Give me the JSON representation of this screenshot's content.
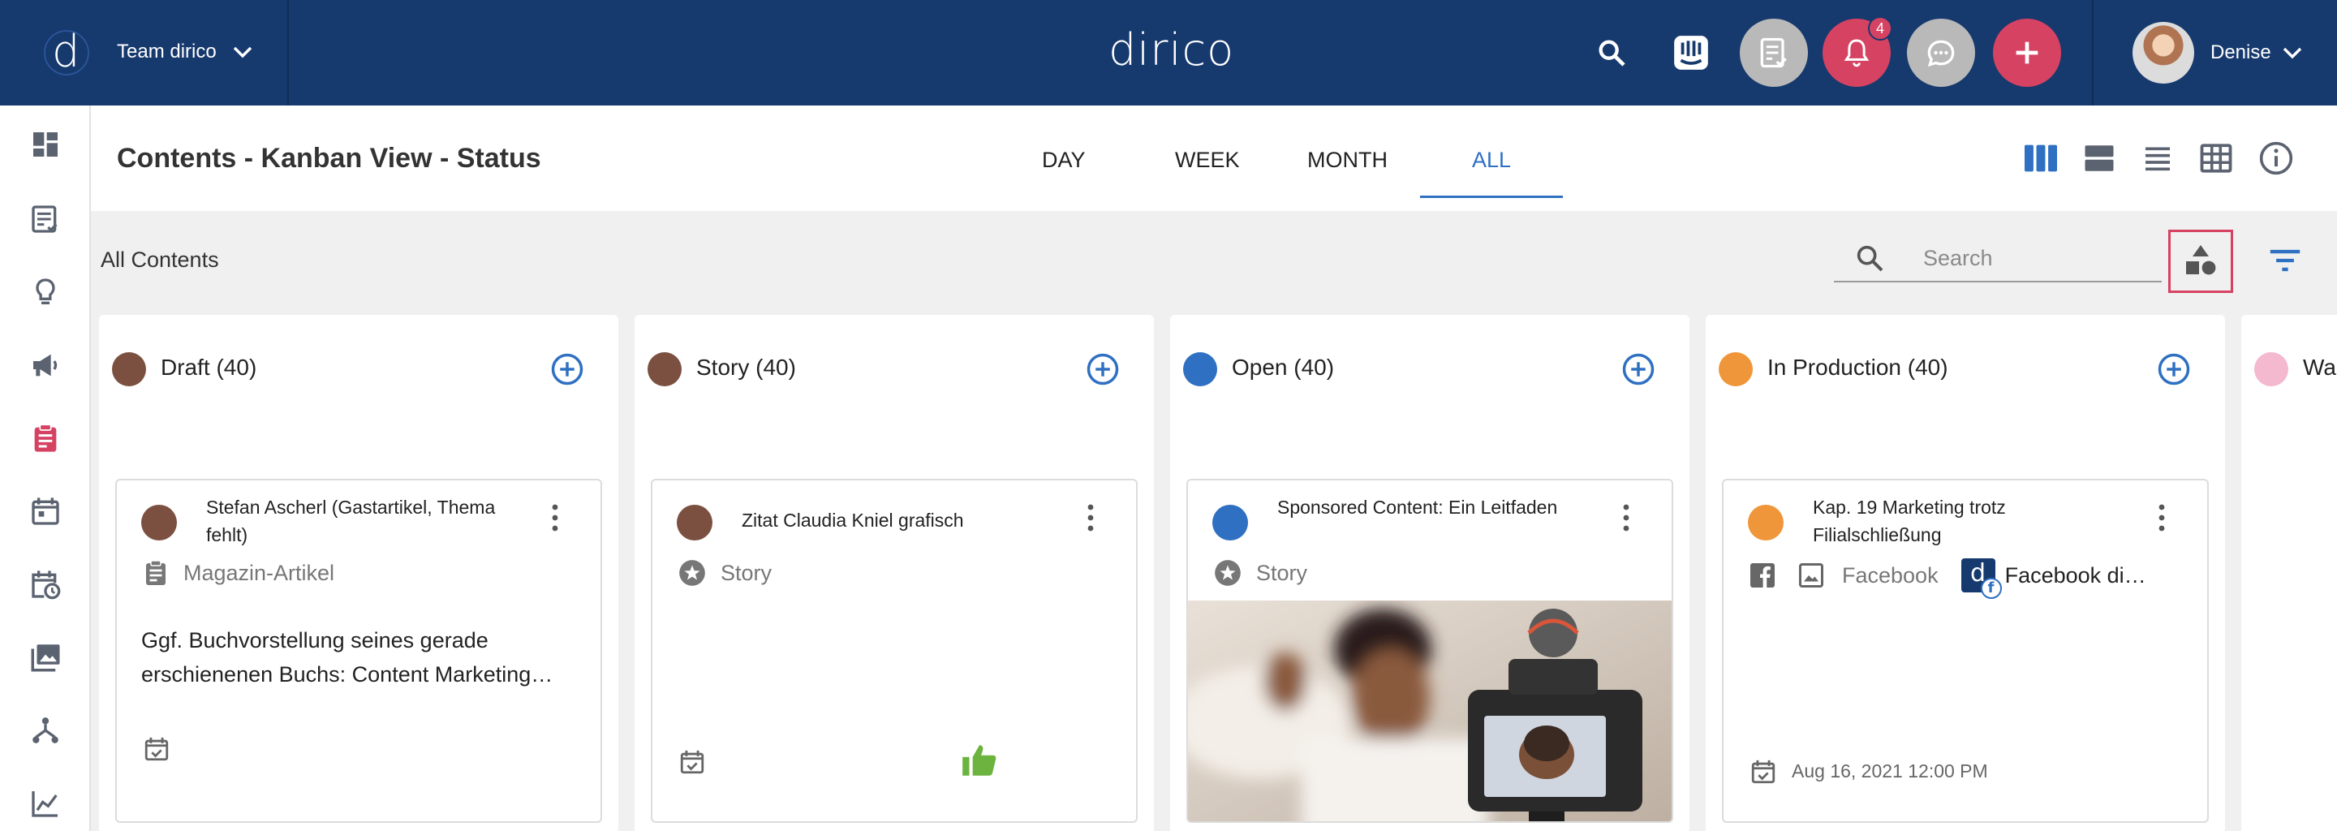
{
  "header": {
    "team_name": "Team dirico",
    "app_title": "dirico",
    "notification_count": "4",
    "user_name": "Denise",
    "colors": {
      "bar": "#16396e",
      "accent": "#d64262",
      "grey_button": "#b9b9b9"
    }
  },
  "sidebar": {
    "items": [
      {
        "icon": "dashboard-icon"
      },
      {
        "icon": "article-list-icon"
      },
      {
        "icon": "lightbulb-icon"
      },
      {
        "icon": "megaphone-icon"
      },
      {
        "icon": "clipboard-icon",
        "active": true
      },
      {
        "icon": "calendar-icon"
      },
      {
        "icon": "calendar-clock-icon"
      },
      {
        "icon": "photo-library-icon"
      },
      {
        "icon": "workflow-icon"
      },
      {
        "icon": "analytics-icon"
      }
    ]
  },
  "page": {
    "title": "Contents - Kanban View - Status",
    "tabs": [
      {
        "label": "DAY"
      },
      {
        "label": "WEEK"
      },
      {
        "label": "MONTH"
      },
      {
        "label": "ALL",
        "active": true
      }
    ],
    "views": [
      "kanban-view-icon",
      "card-view-icon",
      "list-view-icon",
      "table-view-icon",
      "info-icon"
    ]
  },
  "filter": {
    "label": "All Contents",
    "search_placeholder": "Search",
    "search_value": ""
  },
  "columns": [
    {
      "name": "Draft",
      "count": "(40)",
      "color": "#7b5040",
      "card": {
        "title": "Stefan Ascherl (Gastartikel, Thema fehlt)",
        "dot_color": "#7b5040",
        "type": "Magazin-Artikel",
        "description": "Ggf. Buchvorstellung seines gerade erschienenen Buchs: Content Marketing…"
      }
    },
    {
      "name": "Story",
      "count": "(40)",
      "color": "#7b5040",
      "card": {
        "title": "Zitat Claudia Kniel grafisch",
        "dot_color": "#7b5040",
        "type": "Story"
      }
    },
    {
      "name": "Open",
      "count": "(40)",
      "color": "#2f70c2",
      "card": {
        "title": "Sponsored Content: Ein Leitfaden",
        "dot_color": "#2f70c2",
        "type": "Story"
      }
    },
    {
      "name": "In Production",
      "count": "(40)",
      "color": "#f0963a",
      "card": {
        "title": "Kap. 19 Marketing trotz Filialschließung",
        "dot_color": "#f0963a",
        "network_label": "Facebook",
        "channel_label": "Facebook dirico",
        "date": "Aug 16, 2021 12:00 PM"
      }
    },
    {
      "name": "Wa",
      "count": "",
      "color": "#f4b8cf"
    }
  ]
}
